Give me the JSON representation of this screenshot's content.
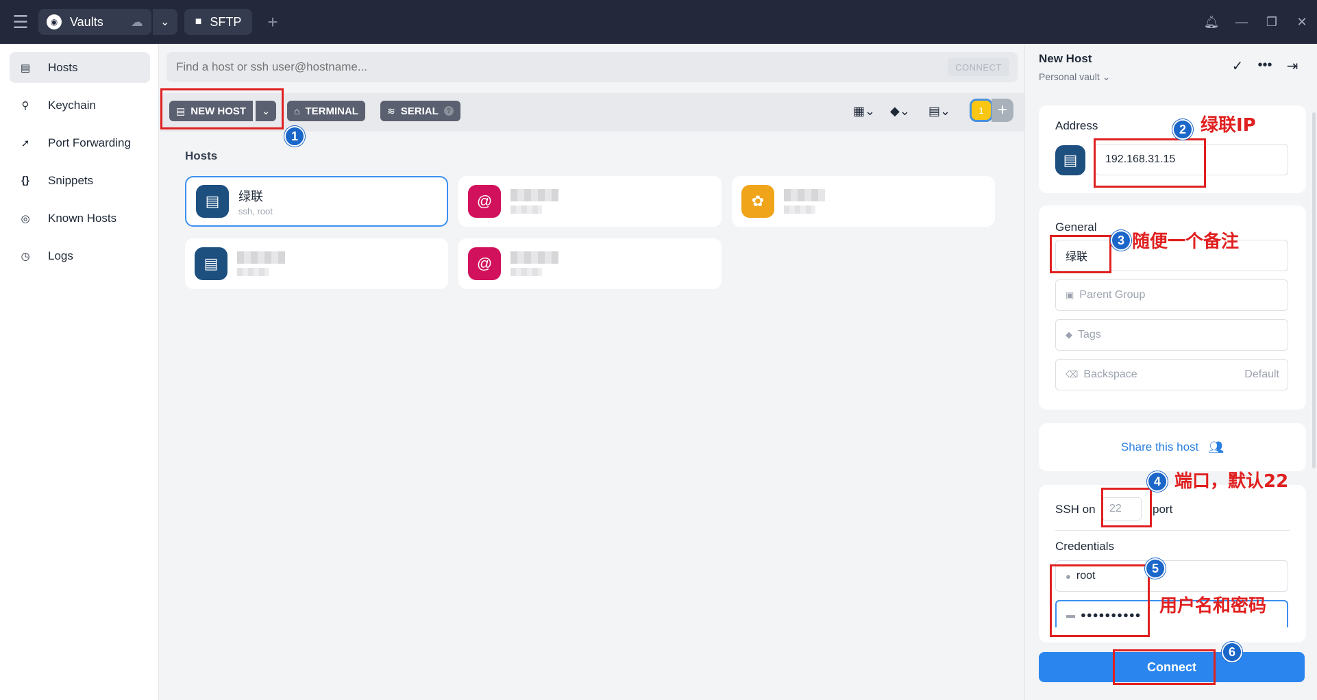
{
  "titlebar": {
    "vault_tab": "Vaults",
    "sftp_tab": "SFTP"
  },
  "nav": {
    "items": [
      {
        "label": "Hosts",
        "icon": "hosts-icon"
      },
      {
        "label": "Keychain",
        "icon": "key-icon"
      },
      {
        "label": "Port Forwarding",
        "icon": "port-forward-icon"
      },
      {
        "label": "Snippets",
        "icon": "snippets-icon"
      },
      {
        "label": "Known Hosts",
        "icon": "fingerprint-icon"
      },
      {
        "label": "Logs",
        "icon": "clock-icon"
      }
    ]
  },
  "search": {
    "placeholder": "Find a host or ssh user@hostname...",
    "connect_label": "CONNECT"
  },
  "toolbar": {
    "new_host": "NEW HOST",
    "terminal": "TERMINAL",
    "serial": "SERIAL",
    "badge_count": "1"
  },
  "hosts": {
    "title": "Hosts",
    "cards": [
      {
        "name": "绿联",
        "sub": "ssh, root"
      }
    ]
  },
  "panel": {
    "title": "New Host",
    "subtitle": "Personal vault",
    "address_label": "Address",
    "address_value": "192.168.31.15",
    "general_label": "General",
    "label_value": "绿联",
    "parent_group_placeholder": "Parent Group",
    "tags_placeholder": "Tags",
    "backspace_label": "Backspace",
    "backspace_value": "Default",
    "share_label": "Share this host",
    "ssh_on": "SSH on",
    "port_placeholder": "22",
    "port_suffix": "port",
    "credentials_label": "Credentials",
    "username": "root",
    "password_mask": "●●●●●●●●●●",
    "connect_button": "Connect"
  },
  "annotations": {
    "n1": "1",
    "n2": "2",
    "n3": "3",
    "n4": "4",
    "n5": "5",
    "n6": "6",
    "t2": "绿联IP",
    "t3": "随便一个备注",
    "t4": "端口，默认22",
    "t5": "用户名和密码"
  },
  "colors": {
    "titlebar_bg": "#23293a",
    "accent_blue": "#2a86ee",
    "annotation_red": "#e02020",
    "host_icon_blue": "#1d4f7f",
    "host_icon_pink": "#d1115b",
    "host_icon_orange": "#f0a419"
  }
}
